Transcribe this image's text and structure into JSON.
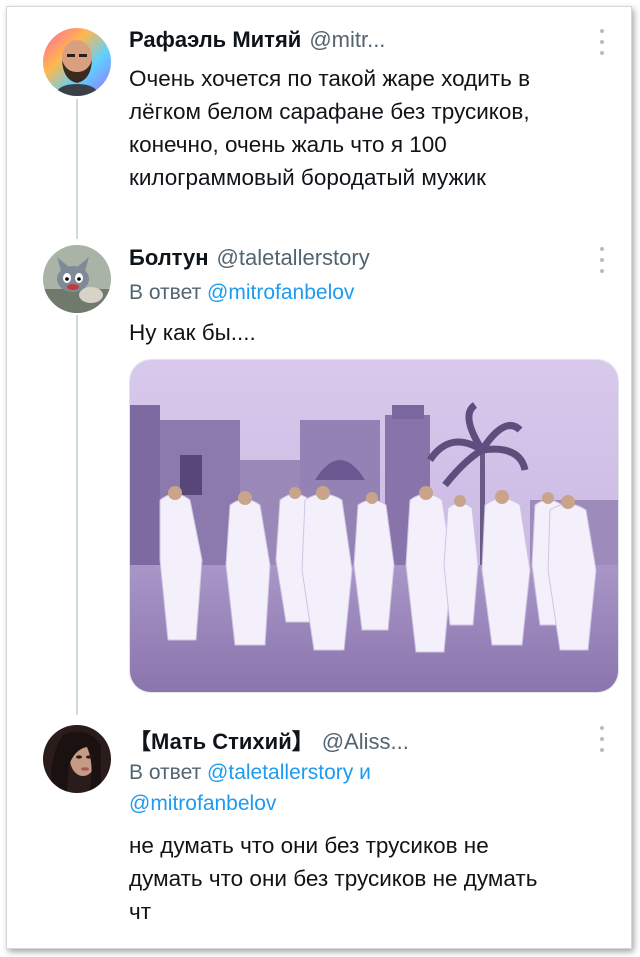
{
  "tweets": [
    {
      "author": "Рафаэль Митяй",
      "handle": "@mitr...",
      "avatar_icon": "bearded-man-avatar",
      "lines": [
        "Очень хочется по такой жаре ходить в",
        "лёгком белом сарафане без трусиков,",
        "конечно, очень жаль что я 100",
        "килограммовый бородатый мужик"
      ]
    },
    {
      "author": "Болтун",
      "handle": "@taletallerstory",
      "avatar_icon": "cartoon-cat-avatar",
      "reply_prefix": "В ответ",
      "reply_mentions": [
        "@mitrofanbelov"
      ],
      "lines": [
        "Ну как бы...."
      ],
      "media_icon": "photo-men-in-white-robes"
    },
    {
      "author": "【Мать Стихий】",
      "handle": "@Aliss...",
      "avatar_icon": "woman-portrait-avatar",
      "reply_prefix": "В ответ",
      "reply_mentions": [
        "@taletallerstory",
        "@mitrofanbelov"
      ],
      "reply_joiner": "и",
      "lines": [
        "не думать что они без трусиков не",
        "думать что они без трусиков не думать",
        "чт"
      ]
    }
  ],
  "colors": {
    "text": "#0f1419",
    "secondary": "#536471",
    "link": "#1d9bf0",
    "thread_line": "#cfd9de",
    "photo_tint": "#b79fd6"
  }
}
